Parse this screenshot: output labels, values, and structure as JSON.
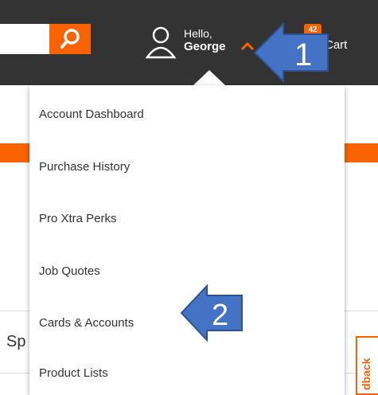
{
  "header": {
    "search": {
      "placeholder": "",
      "value": ""
    },
    "account": {
      "greeting": "Hello,",
      "name": "George"
    },
    "cart": {
      "count": "42",
      "label": "Cart"
    }
  },
  "menu": {
    "items": [
      {
        "label": "Account Dashboard"
      },
      {
        "label": "Purchase History"
      },
      {
        "label": "Pro Xtra Perks"
      },
      {
        "label": "Job Quotes"
      },
      {
        "label": "Cards & Accounts"
      },
      {
        "label": "Product Lists"
      }
    ]
  },
  "background": {
    "partial_text": "Sp",
    "feedback_partial": "dback"
  },
  "callouts": [
    {
      "number": "1"
    },
    {
      "number": "2"
    }
  ],
  "colors": {
    "brand": "#f96302",
    "header_bg": "#333333",
    "callout_fill": "#4472c4"
  }
}
